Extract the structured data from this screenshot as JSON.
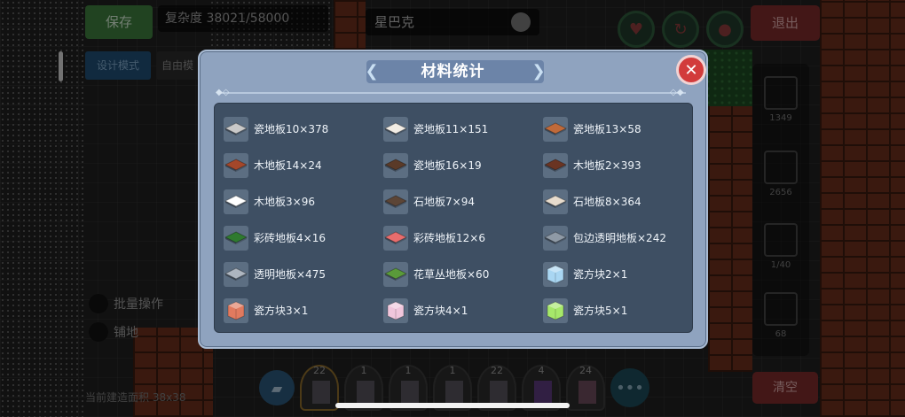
{
  "hud": {
    "save_label": "保存",
    "complexity_text": "复杂度 38021/58000",
    "shop_name": "星巴克",
    "design_mode_label": "设计模式",
    "free_mode_label": "自由模",
    "exit_label": "退出",
    "clear_label": "清空",
    "batch_label": "批量操作",
    "floor_label": "铺地",
    "area_text": "当前建造面积 38x38",
    "right_panel": [
      "1349",
      "2656",
      "1/40",
      "68"
    ],
    "hotbar_counts": [
      "22",
      "1",
      "1",
      "1",
      "22",
      "4",
      "24"
    ]
  },
  "modal": {
    "title": "材料统计",
    "items": [
      {
        "label": "瓷地板10×378",
        "icon": "tile-grey-check",
        "color": "#c9c9c9"
      },
      {
        "label": "瓷地板11×151",
        "icon": "tile-white",
        "color": "#f1ece4"
      },
      {
        "label": "瓷地板13×58",
        "icon": "tile-orange-check",
        "color": "#c06a3a"
      },
      {
        "label": "木地板14×24",
        "icon": "tile-brown",
        "color": "#a4472a"
      },
      {
        "label": "瓷地板16×19",
        "icon": "tile-dark-pattern",
        "color": "#5a3a28"
      },
      {
        "label": "木地板2×393",
        "icon": "tile-dark-brown",
        "color": "#6a3422"
      },
      {
        "label": "木地板3×96",
        "icon": "tile-white-wood",
        "color": "#ffffff"
      },
      {
        "label": "石地板7×94",
        "icon": "tile-stone-dark",
        "color": "#5c4536"
      },
      {
        "label": "石地板8×364",
        "icon": "tile-stone-light",
        "color": "#e8dccd"
      },
      {
        "label": "彩砖地板4×16",
        "icon": "tile-green",
        "color": "#2f7a2f"
      },
      {
        "label": "彩砖地板12×6",
        "icon": "tile-pink",
        "color": "#e86d6d"
      },
      {
        "label": "包边透明地板×242",
        "icon": "tile-glass-edge",
        "color": "#8f9aa6"
      },
      {
        "label": "透明地板×475",
        "icon": "tile-glass",
        "color": "#aeb6c0"
      },
      {
        "label": "花草丛地板×60",
        "icon": "tile-grass",
        "color": "#5a9a3a"
      },
      {
        "label": "瓷方块2×1",
        "icon": "cube-light-blue",
        "color": "#a9d6f2"
      },
      {
        "label": "瓷方块3×1",
        "icon": "cube-salmon",
        "color": "#e07a5f"
      },
      {
        "label": "瓷方块4×1",
        "icon": "cube-pink",
        "color": "#f0c6dc"
      },
      {
        "label": "瓷方块5×1",
        "icon": "cube-lime",
        "color": "#a6e86a"
      }
    ]
  }
}
